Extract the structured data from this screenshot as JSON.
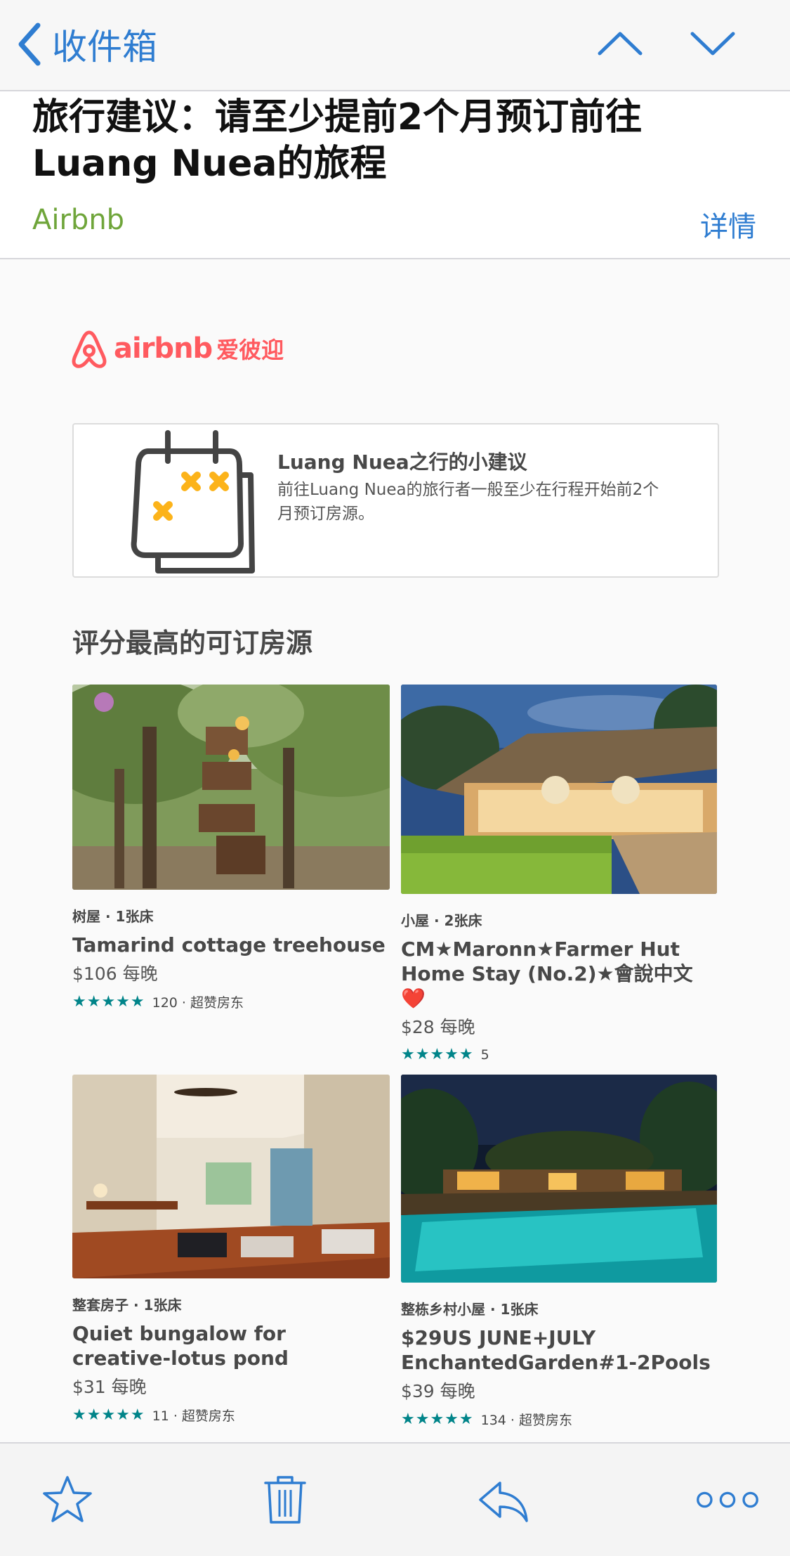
{
  "nav": {
    "back_label": "收件箱"
  },
  "header": {
    "subject": "旅行建议：请至少提前2个月预订前往Luang Nuea的旅程",
    "sender": "Airbnb",
    "details_label": "详情"
  },
  "brand": {
    "logo_text": "airbnb",
    "logo_cn": "爱彼迎",
    "color": "#ff5a5f"
  },
  "tip": {
    "title": "Luang Nuea之行的小建议",
    "text": "前往Luang Nuea的旅行者一般至少在行程开始前2个月预订房源。"
  },
  "section_title": "评分最高的可订房源",
  "listings": [
    {
      "type": "树屋 · 1张床",
      "title": "Tamarind cottage treehouse",
      "price": "$106 每晚",
      "stars": "★★★★★",
      "reviews": "120 · 超赞房东",
      "image": "treehouse-photo"
    },
    {
      "type": "小屋 · 2张床",
      "title": "CM★Maronn★Farmer Hut Home Stay (No.2)★會說中文❤️",
      "price": "$28 每晚",
      "stars": "★★★★★",
      "reviews": "5",
      "image": "farmer-hut-photo"
    },
    {
      "type": "整套房子 · 1张床",
      "title": "Quiet bungalow for creative-lotus pond",
      "price": "$31 每晚",
      "stars": "★★★★★",
      "reviews": "11 · 超赞房东",
      "image": "bungalow-interior-photo"
    },
    {
      "type": "整栋乡村小屋 · 1张床",
      "title": "$29US JUNE+JULY EnchantedGarden#1-2Pools",
      "price": "$39 每晚",
      "stars": "★★★★★",
      "reviews": "134 · 超赞房东",
      "image": "pool-garden-photo"
    }
  ],
  "toolbar": {
    "icons": [
      "star-icon",
      "trash-icon",
      "reply-icon",
      "more-icon"
    ]
  },
  "colors": {
    "ios_blue": "#2f7dd1",
    "sender_green": "#6fa53a",
    "rating_teal": "#008489"
  }
}
